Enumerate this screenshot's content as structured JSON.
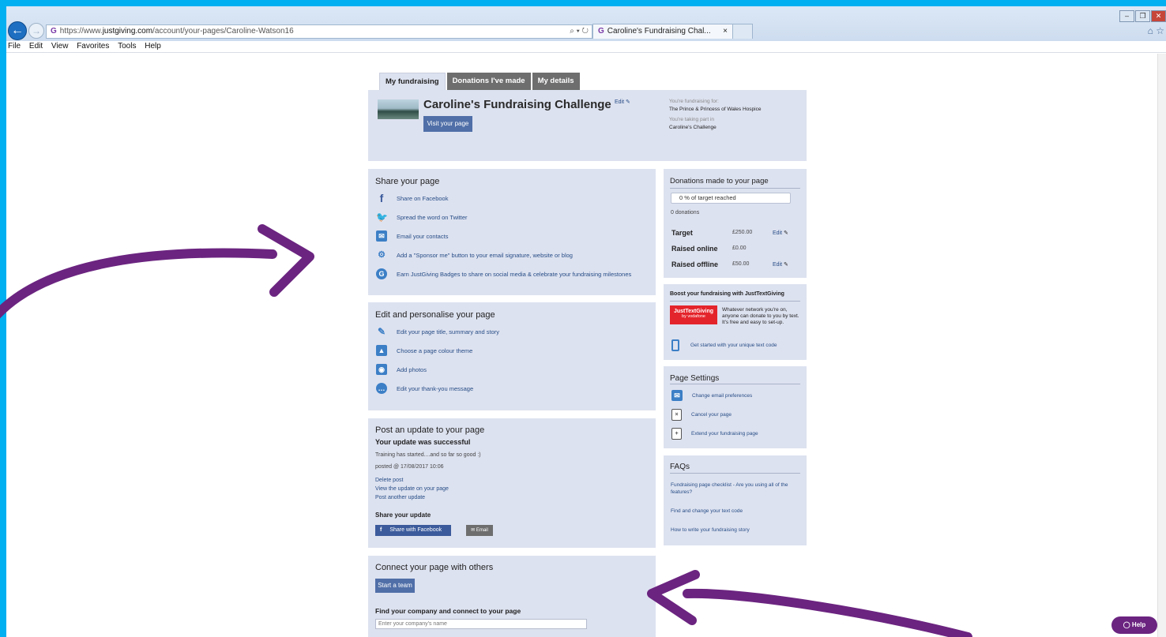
{
  "browser": {
    "url_prefix": "https://www.",
    "url_domain": "justgiving.com",
    "url_path": "/account/your-pages/Caroline-Watson16",
    "address_tools": "⌕ ▾ ↻",
    "tab_title": "Caroline's Fundraising Chal...",
    "tab_close": "×",
    "menu": [
      "File",
      "Edit",
      "View",
      "Favorites",
      "Tools",
      "Help"
    ]
  },
  "tabs": [
    "My fundraising",
    "Donations I've made",
    "My details"
  ],
  "header": {
    "title": "Caroline's Fundraising Challenge",
    "edit_label": "Edit",
    "visit_button": "Visit your page",
    "fundraising_for_label": "You're fundraising for:",
    "fundraising_for_value": "The Prince & Princess of Wales Hospice",
    "taking_part_label": "You're taking part in",
    "taking_part_value": "Caroline's Challenge"
  },
  "share": {
    "heading": "Share your page",
    "items": [
      "Share on Facebook",
      "Spread the word on Twitter",
      "Email your contacts",
      "Add a \"Sponsor me\" button to your email signature, website or blog",
      "Earn JustGiving Badges to share on social media & celebrate your fundraising milestones"
    ]
  },
  "edit": {
    "heading": "Edit and personalise your page",
    "items": [
      "Edit your page title, summary and story",
      "Choose a page colour theme",
      "Add photos",
      "Edit your thank-you message"
    ]
  },
  "update": {
    "heading": "Post an update to your page",
    "success": "Your update was successful",
    "message": "Training has started....and so far so good :)",
    "posted": "posted @ 17/08/2017 10:06",
    "links": [
      "Delete post",
      "View the update on your page",
      "Post another update"
    ],
    "share_heading": "Share your update",
    "share_facebook": "Share with Facebook",
    "share_email": "Email"
  },
  "connect": {
    "heading": "Connect your page with others",
    "team_button": "Start a team",
    "company_heading": "Find your company and connect to your page",
    "company_placeholder": "Enter your company's name"
  },
  "donations": {
    "heading": "Donations made to your page",
    "progress_text": "0 % of target reached",
    "progress_fraction": 0,
    "count": "0 donations",
    "target_label": "Target",
    "target_value": "£250.00",
    "online_label": "Raised online",
    "online_value": "£0.00",
    "offline_label": "Raised offline",
    "offline_value": "£50.00",
    "edit_label": "Edit"
  },
  "boost": {
    "heading": "Boost your fundraising with JustTextGiving",
    "logo_line1": "JustTextGiving",
    "logo_line2": "by vodafone",
    "description": "Whatever network you're on, anyone can donate to you by text. It's free and easy to set-up.",
    "cta": "Get started with your unique text code"
  },
  "settings": {
    "heading": "Page Settings",
    "items": [
      "Change email preferences",
      "Cancel your page",
      "Extend your fundraising page"
    ]
  },
  "faqs": {
    "heading": "FAQs",
    "items": [
      "Fundraising page checklist - Are you using all of the features?",
      "Find and change your text code",
      "How to write your fundraising story"
    ]
  },
  "help_button": "Help",
  "colors": {
    "frame": "#00b0f0",
    "panel": "#dde2f0",
    "button": "#506fa8",
    "arrow": "#6b2480"
  }
}
